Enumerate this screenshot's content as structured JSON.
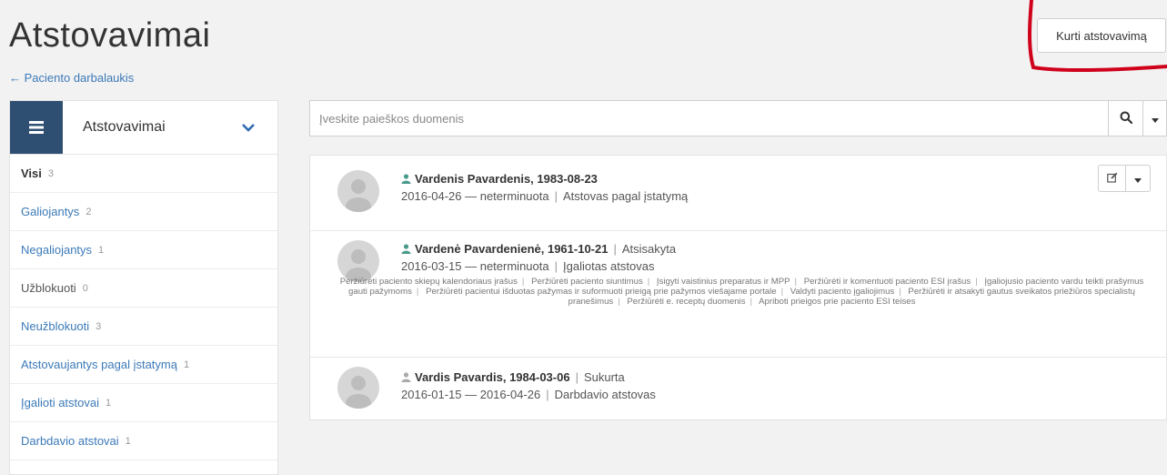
{
  "header": {
    "title": "Atstovavimai",
    "back_link": "← Paciento darbalaukis",
    "create_button": "Kurti atstovavimą"
  },
  "sidebar": {
    "title": "Atstovavimai",
    "items": [
      {
        "label": "Visi",
        "count": "3"
      },
      {
        "label": "Galiojantys",
        "count": "2"
      },
      {
        "label": "Negaliojantys",
        "count": "1"
      },
      {
        "label": "Užblokuoti",
        "count": "0"
      },
      {
        "label": "Neužblokuoti",
        "count": "3"
      },
      {
        "label": "Atstovaujantys pagal įstatymą",
        "count": "1"
      },
      {
        "label": "Įgalioti atstovai",
        "count": "1"
      },
      {
        "label": "Darbdavio atstovai",
        "count": "1"
      }
    ]
  },
  "search": {
    "placeholder": "Įveskite paieškos duomenis"
  },
  "entries": [
    {
      "name": "Vardenis Pavardenis, 1983-08-23",
      "status": "",
      "period": "2016-04-26 — neterminuota",
      "type": "Atstovas pagal įstatymą"
    },
    {
      "name": "Vardenė Pavardenienė, 1961-10-21",
      "status": "Atsisakyta",
      "period": "2016-03-15 — neterminuota",
      "type": "Įgaliotas atstovas",
      "permissions": [
        "Peržiūrėti paciento skiepų kalendoriaus įrašus",
        "Peržiūrėti paciento siuntimus",
        "Įsigyti vaistinius preparatus ir MPP",
        "Peržiūrėti ir komentuoti paciento ESI įrašus",
        "Įgaliojusio paciento vardu teikti prašymus gauti pažymoms",
        "Peržiūrėti pacientui išduotas pažymas ir suformuoti prieigą prie pažymos viešajame portale",
        "Valdyti paciento įgaliojimus",
        "Peržiūrėti ir atsakyti gautus sveikatos priežiūros specialistų pranešimus",
        "Peržiūrėti e. receptų duomenis",
        "Apriboti prieigos prie paciento ESI teises"
      ]
    },
    {
      "name": "Vardis Pavardis, 1984-03-06",
      "status": "Sukurta",
      "period": "2016-01-15 — 2016-04-26",
      "type": "Darbdavio atstovas"
    }
  ],
  "colors": {
    "accent": "#3c7ab8",
    "sidebar_icon_bg": "#2f4f72",
    "person_active": "#4a9a8c",
    "person_inactive": "#aaaaaa",
    "annotation": "#d0021b"
  },
  "icons": [
    "list-icon",
    "chevron-down-icon",
    "search-icon",
    "caret-down-icon",
    "person-icon",
    "edit-icon"
  ]
}
